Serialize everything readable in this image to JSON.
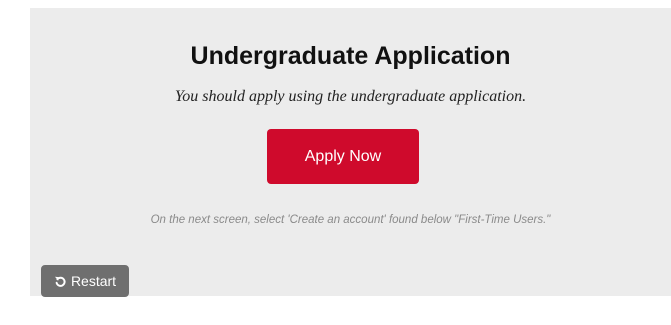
{
  "panel": {
    "title": "Undergraduate Application",
    "subtitle": "You should apply using the undergraduate application.",
    "apply_label": "Apply Now",
    "note": "On the next screen, select 'Create an account' found below \"First-Time Users.\"",
    "restart_label": "Restart",
    "restart_icon": "undo-icon"
  },
  "colors": {
    "panel_bg": "#ececec",
    "apply_bg": "#cf0a2c",
    "restart_bg": "#6f6f6f"
  }
}
